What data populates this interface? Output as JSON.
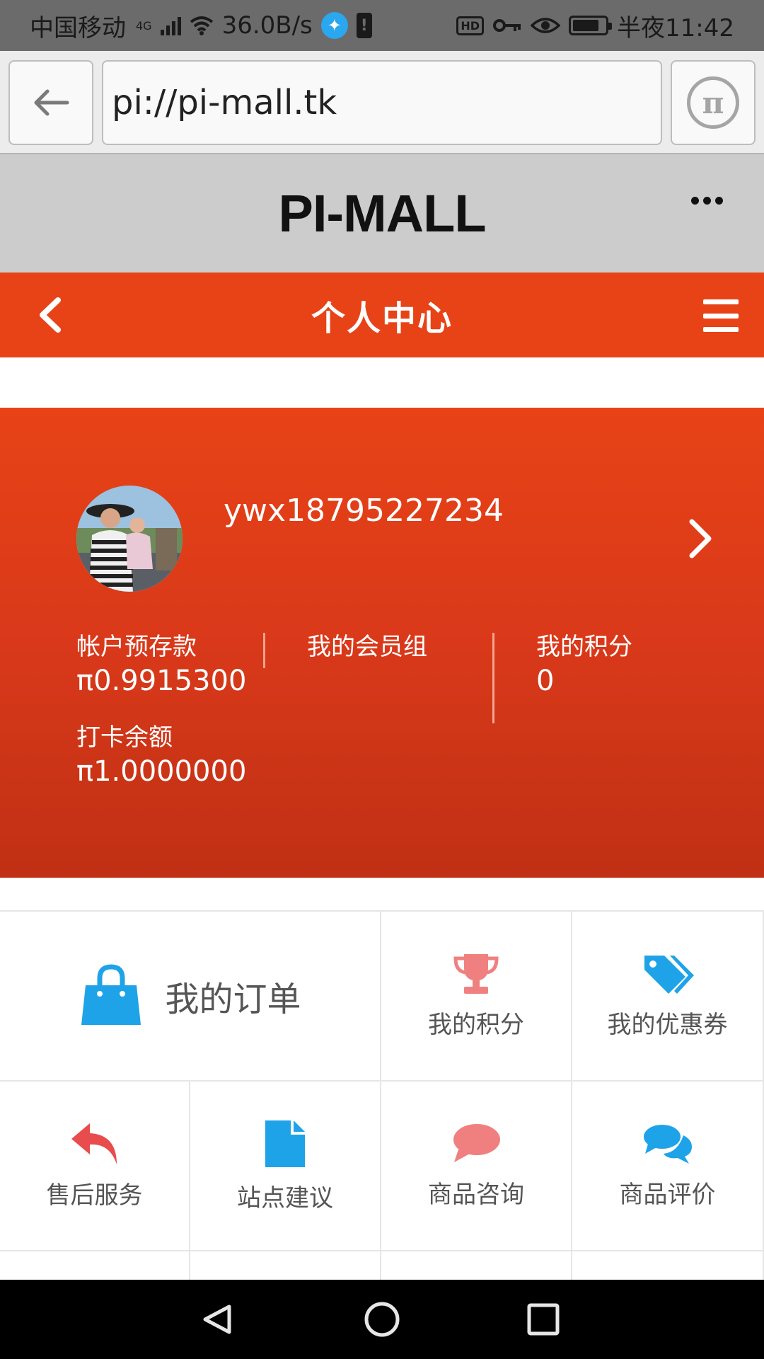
{
  "status_bar": {
    "carrier": "中国移动",
    "network": "4G",
    "speed": "36.0B/s",
    "time": "半夜11:42",
    "hd": "HD",
    "icons": [
      "signal-icon",
      "wifi-icon",
      "app-notify-icon",
      "alert-icon",
      "hd-icon",
      "key-icon",
      "eye-icon",
      "battery-icon"
    ]
  },
  "browser": {
    "url": "pi://pi-mall.tk",
    "pi_symbol": "π"
  },
  "mall_header": {
    "title": "PI-MALL"
  },
  "nav": {
    "title": "个人中心"
  },
  "profile": {
    "username": "ywx18795227234",
    "stats": [
      {
        "label": "帐户预存款",
        "value": "π0.9915300"
      },
      {
        "label": "我的会员组",
        "value": ""
      },
      {
        "label": "我的积分",
        "value": "0"
      },
      {
        "label": "打卡余额",
        "value": "π1.0000000"
      }
    ]
  },
  "menu": {
    "orders": "我的订单",
    "points": "我的积分",
    "coupons": "我的优惠券",
    "after_sales": "售后服务",
    "suggestions": "站点建议",
    "consult": "商品咨询",
    "reviews": "商品评价"
  },
  "colors": {
    "brand_orange": "#e84317",
    "icon_blue": "#1fa3e8",
    "icon_pink": "#f08080",
    "icon_red": "#e84c4c"
  }
}
